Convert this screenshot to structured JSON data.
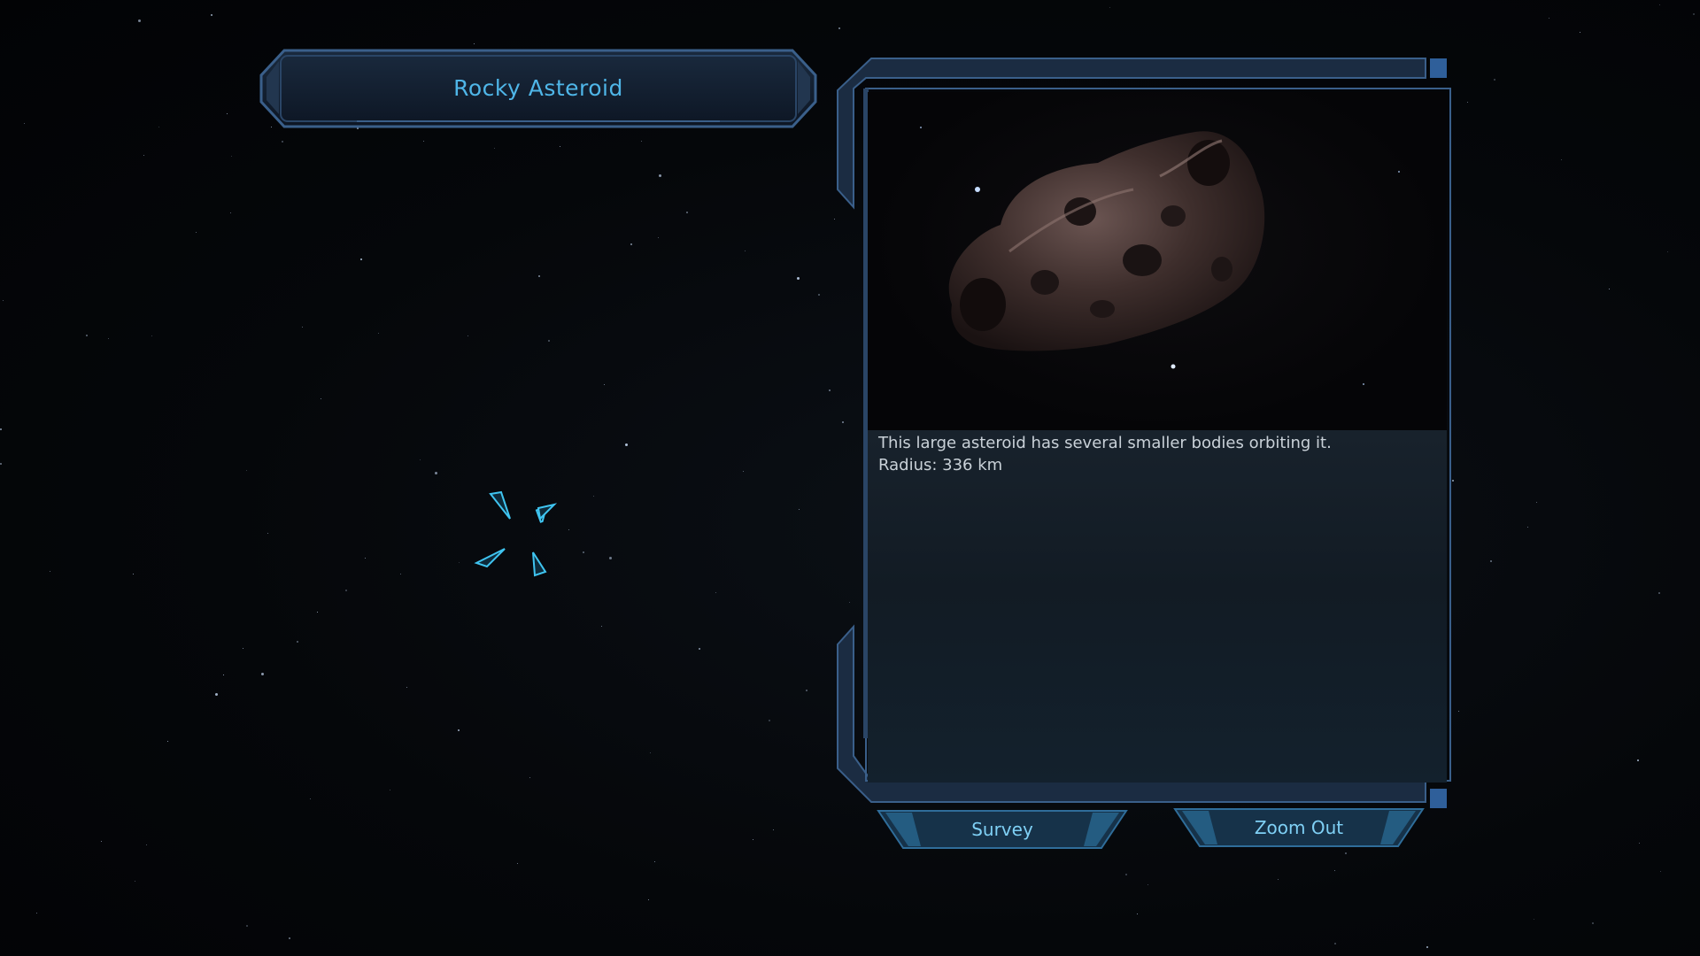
{
  "title": "Rocky Asteroid",
  "info_panel": {
    "description": "This large asteroid has several smaller bodies orbiting it.",
    "radius": "Radius: 336 km"
  },
  "buttons": {
    "survey": "Survey",
    "zoom_out": "Zoom Out"
  },
  "colors": {
    "accent": "#4fb6e8",
    "frame": "#3a5f8a",
    "button_text": "#7fd0f5"
  },
  "icons": {
    "reticle": "target-reticle-icon"
  }
}
